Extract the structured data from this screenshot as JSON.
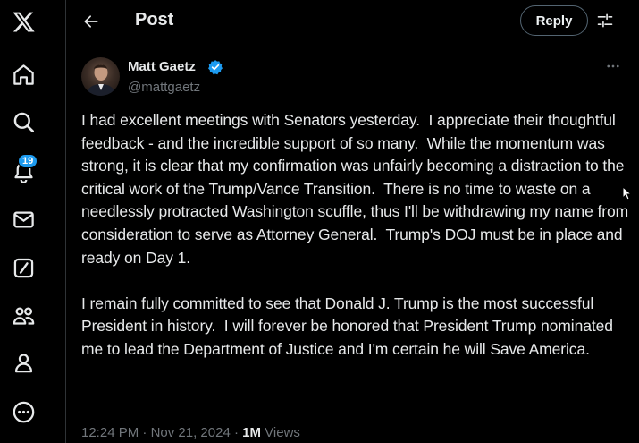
{
  "nav": {
    "items": [
      {
        "name": "x-logo-icon"
      },
      {
        "name": "home-icon"
      },
      {
        "name": "explore-icon"
      },
      {
        "name": "notifications-icon",
        "badge": "19"
      },
      {
        "name": "messages-icon"
      },
      {
        "name": "grok-icon"
      },
      {
        "name": "communities-icon"
      },
      {
        "name": "profile-icon"
      },
      {
        "name": "more-icon"
      }
    ]
  },
  "header": {
    "title": "Post",
    "reply_label": "Reply"
  },
  "post": {
    "author_name": "Matt Gaetz",
    "author_handle": "@mattgaetz",
    "text": "I had excellent meetings with Senators yesterday.  I appreciate their thoughtful feedback - and the incredible support of so many.  While the momentum was strong, it is clear that my confirmation was unfairly becoming a distraction to the critical work of the Trump/Vance Transition.  There is no time to waste on a needlessly protracted Washington scuffle, thus I'll be withdrawing my name from consideration to serve as Attorney General.  Trump's DOJ must be in place and ready on Day 1.\n\nI remain fully committed to see that Donald J. Trump is the most successful President in history.  I will forever be honored that President Trump nominated me to lead the Department of Justice and I'm certain he will Save America.",
    "time": "12:24 PM",
    "date": "Nov 21, 2024",
    "views_count": "1M",
    "views_label": "Views"
  },
  "colors": {
    "background": "#000000",
    "text": "#e7e9ea",
    "secondary_text": "#71767b",
    "accent": "#1d9bf0",
    "border": "#2f3336"
  }
}
